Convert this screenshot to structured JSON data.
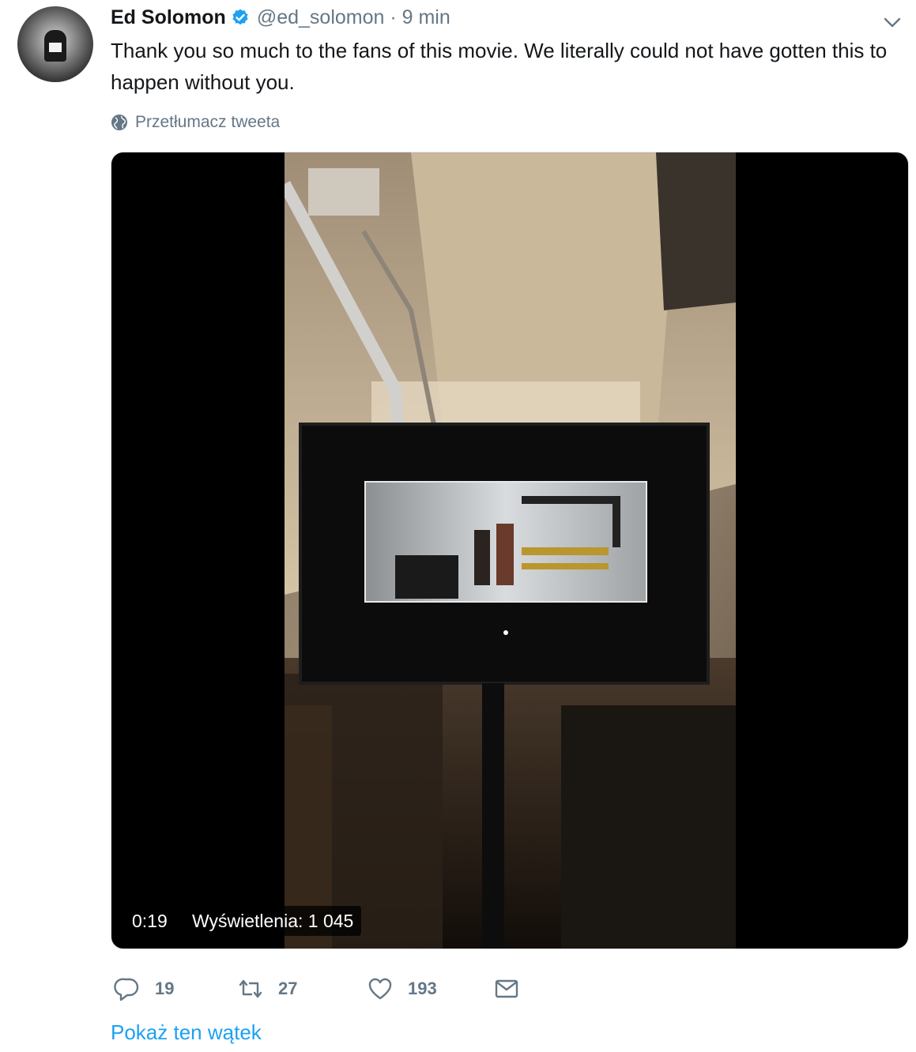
{
  "tweet": {
    "author_name": "Ed Solomon",
    "handle_time": "@ed_solomon · 9 min",
    "text": "Thank you so much to the fans of this movie. We literally could not have gotten this to happen without you.",
    "translate_label": "Przetłumacz tweeta",
    "show_thread_label": "Pokaż ten wątek"
  },
  "video": {
    "duration": "0:19",
    "views": "Wyświetlenia: 1 045"
  },
  "actions": {
    "replies": "19",
    "retweets": "27",
    "likes": "193"
  },
  "icons": {
    "verified": "verified-badge-icon",
    "chevron": "chevron-down-icon",
    "globe": "globe-icon",
    "reply": "reply-icon",
    "retweet": "retweet-icon",
    "like": "heart-icon",
    "dm": "envelope-icon"
  },
  "colors": {
    "accent": "#1da1f2",
    "muted": "#657786",
    "text": "#14171a"
  }
}
